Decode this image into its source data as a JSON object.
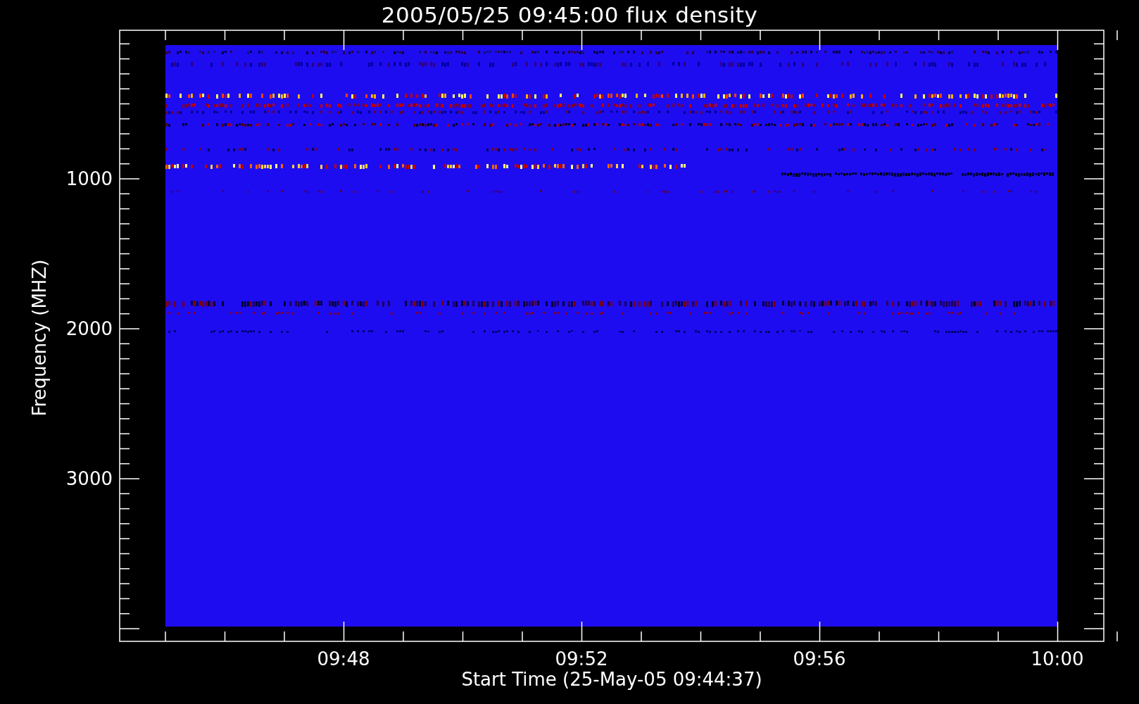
{
  "title": "2005/05/25 09:45:00 flux density",
  "y_axis": {
    "label": "Frequency (MHZ)",
    "ticks": [
      "1000",
      "2000",
      "3000"
    ]
  },
  "x_axis": {
    "label": "Start Time (25-May-05 09:44:37)",
    "ticks": [
      "09:48",
      "09:52",
      "09:56",
      "10:00"
    ]
  }
}
